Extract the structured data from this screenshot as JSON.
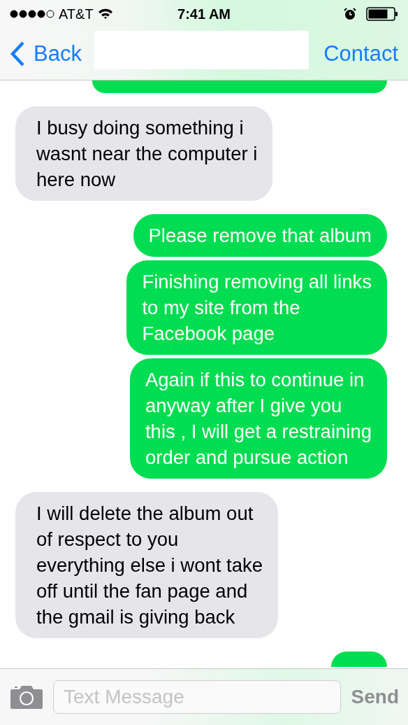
{
  "status_bar": {
    "carrier": "AT&T",
    "time": "7:41 AM"
  },
  "nav": {
    "back": "Back",
    "action": "Contact"
  },
  "messages": [
    {
      "kind": "sent_partial"
    },
    {
      "kind": "received",
      "text": "I busy doing something i\nwasnt near the computer i\nhere now"
    },
    {
      "kind": "sent",
      "text": "Please remove that album"
    },
    {
      "kind": "sent",
      "text": "Finishing removing all links\nto my site from the\nFacebook page"
    },
    {
      "kind": "sent",
      "text": "Again if this to continue in\nanyway after I give you\nthis , I will get a restraining\norder and pursue action"
    },
    {
      "kind": "received",
      "text": "I will delete the album out\nof respect to you\neverything else i wont take\noff until the fan page and\nthe gmail is giving back"
    },
    {
      "kind": "sent_partial_bottom"
    }
  ],
  "composer": {
    "placeholder": "Text Message",
    "send": "Send",
    "disabled": true
  }
}
